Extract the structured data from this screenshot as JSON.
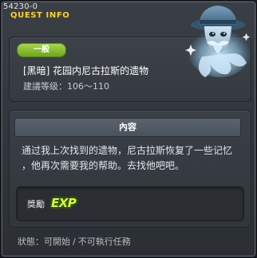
{
  "window": {
    "quest_id": "54230-0",
    "header_label": "QUEST INFO"
  },
  "quest": {
    "badge": "一般",
    "title": "[黑暗] 花园内尼古拉斯的遗物",
    "level": "建議等级：106～110"
  },
  "content": {
    "header": "內容",
    "lines": [
      "通过我上次找到的遗物，尼古拉斯恢复了一些记忆",
      "，他再次需要我的帮助。去找他吧吧。"
    ]
  },
  "reward": {
    "label": "獎勵",
    "icon_text": "EXP",
    "icon": "exp-icon"
  },
  "status": {
    "prefix": "狀態：",
    "available": "可開始",
    "separator": "/",
    "unavailable": "不可執行任務"
  },
  "colors": {
    "header_label": "#ffd21e",
    "badge": "#8bc036",
    "exp": "#d6ff3a"
  }
}
